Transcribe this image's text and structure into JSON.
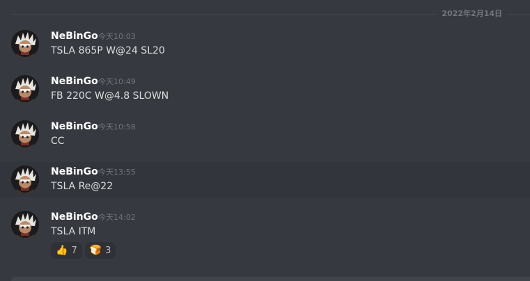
{
  "date_divider": "2022年2月14日",
  "messages": [
    {
      "author": "NeBinGo",
      "time": "今天10:03",
      "content": "TSLA 865P W@24 SL20"
    },
    {
      "author": "NeBinGo",
      "time": "今天10:49",
      "content": "FB 220C W@4.8 SLOWN"
    },
    {
      "author": "NeBinGo",
      "time": "今天10:58",
      "content": "CC"
    },
    {
      "author": "NeBinGo",
      "time": "今天13:55",
      "content": "TSLA Re@22"
    },
    {
      "author": "NeBinGo",
      "time": "今天14:02",
      "content": "TSLA ITM"
    }
  ],
  "reactions": [
    {
      "emoji": "👍",
      "icon": "thumbs-up-icon",
      "count": "7"
    },
    {
      "emoji": "🍞",
      "icon": "bread-icon",
      "count": "3"
    }
  ],
  "colors": {
    "background": "#36393f",
    "hover_row": "#32353b",
    "author": "#ffffff",
    "message_text": "#dcddde",
    "timestamp": "#72767d"
  }
}
